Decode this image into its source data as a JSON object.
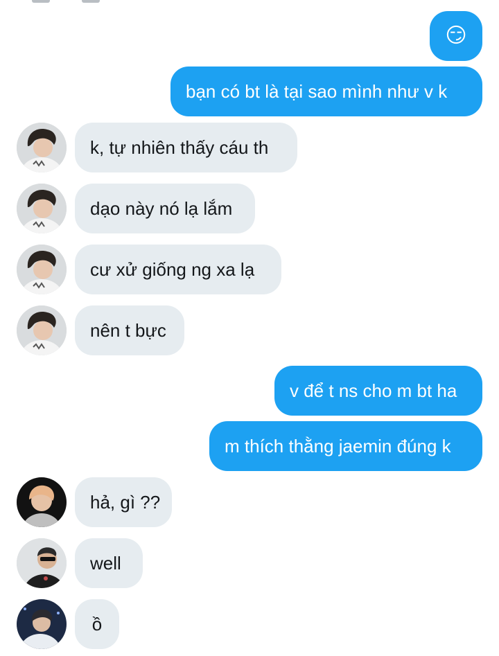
{
  "messages": [
    {
      "side": "sent",
      "text": "😏"
    },
    {
      "side": "sent",
      "text": "bạn có bt là tại sao mình như v k"
    },
    {
      "side": "received",
      "text": "k, tự nhiên thấy cáu th"
    },
    {
      "side": "received",
      "text": "dạo này nó lạ lắm"
    },
    {
      "side": "received",
      "text": "cư xử giống ng xa lạ"
    },
    {
      "side": "received",
      "text": "nên t bực"
    },
    {
      "side": "sent",
      "text": "v để t ns cho m bt ha"
    },
    {
      "side": "sent",
      "text": "m thích thằng jaemin đúng k"
    },
    {
      "side": "received",
      "text": "hả, gì ??"
    },
    {
      "side": "received",
      "text": "well"
    },
    {
      "side": "received",
      "text": "ồ"
    }
  ],
  "colors": {
    "sent_bubble": "#1DA1F2",
    "received_bubble": "#E6ECF0",
    "received_text": "#14171A"
  },
  "icons": [
    "contact-avatar-icon"
  ]
}
